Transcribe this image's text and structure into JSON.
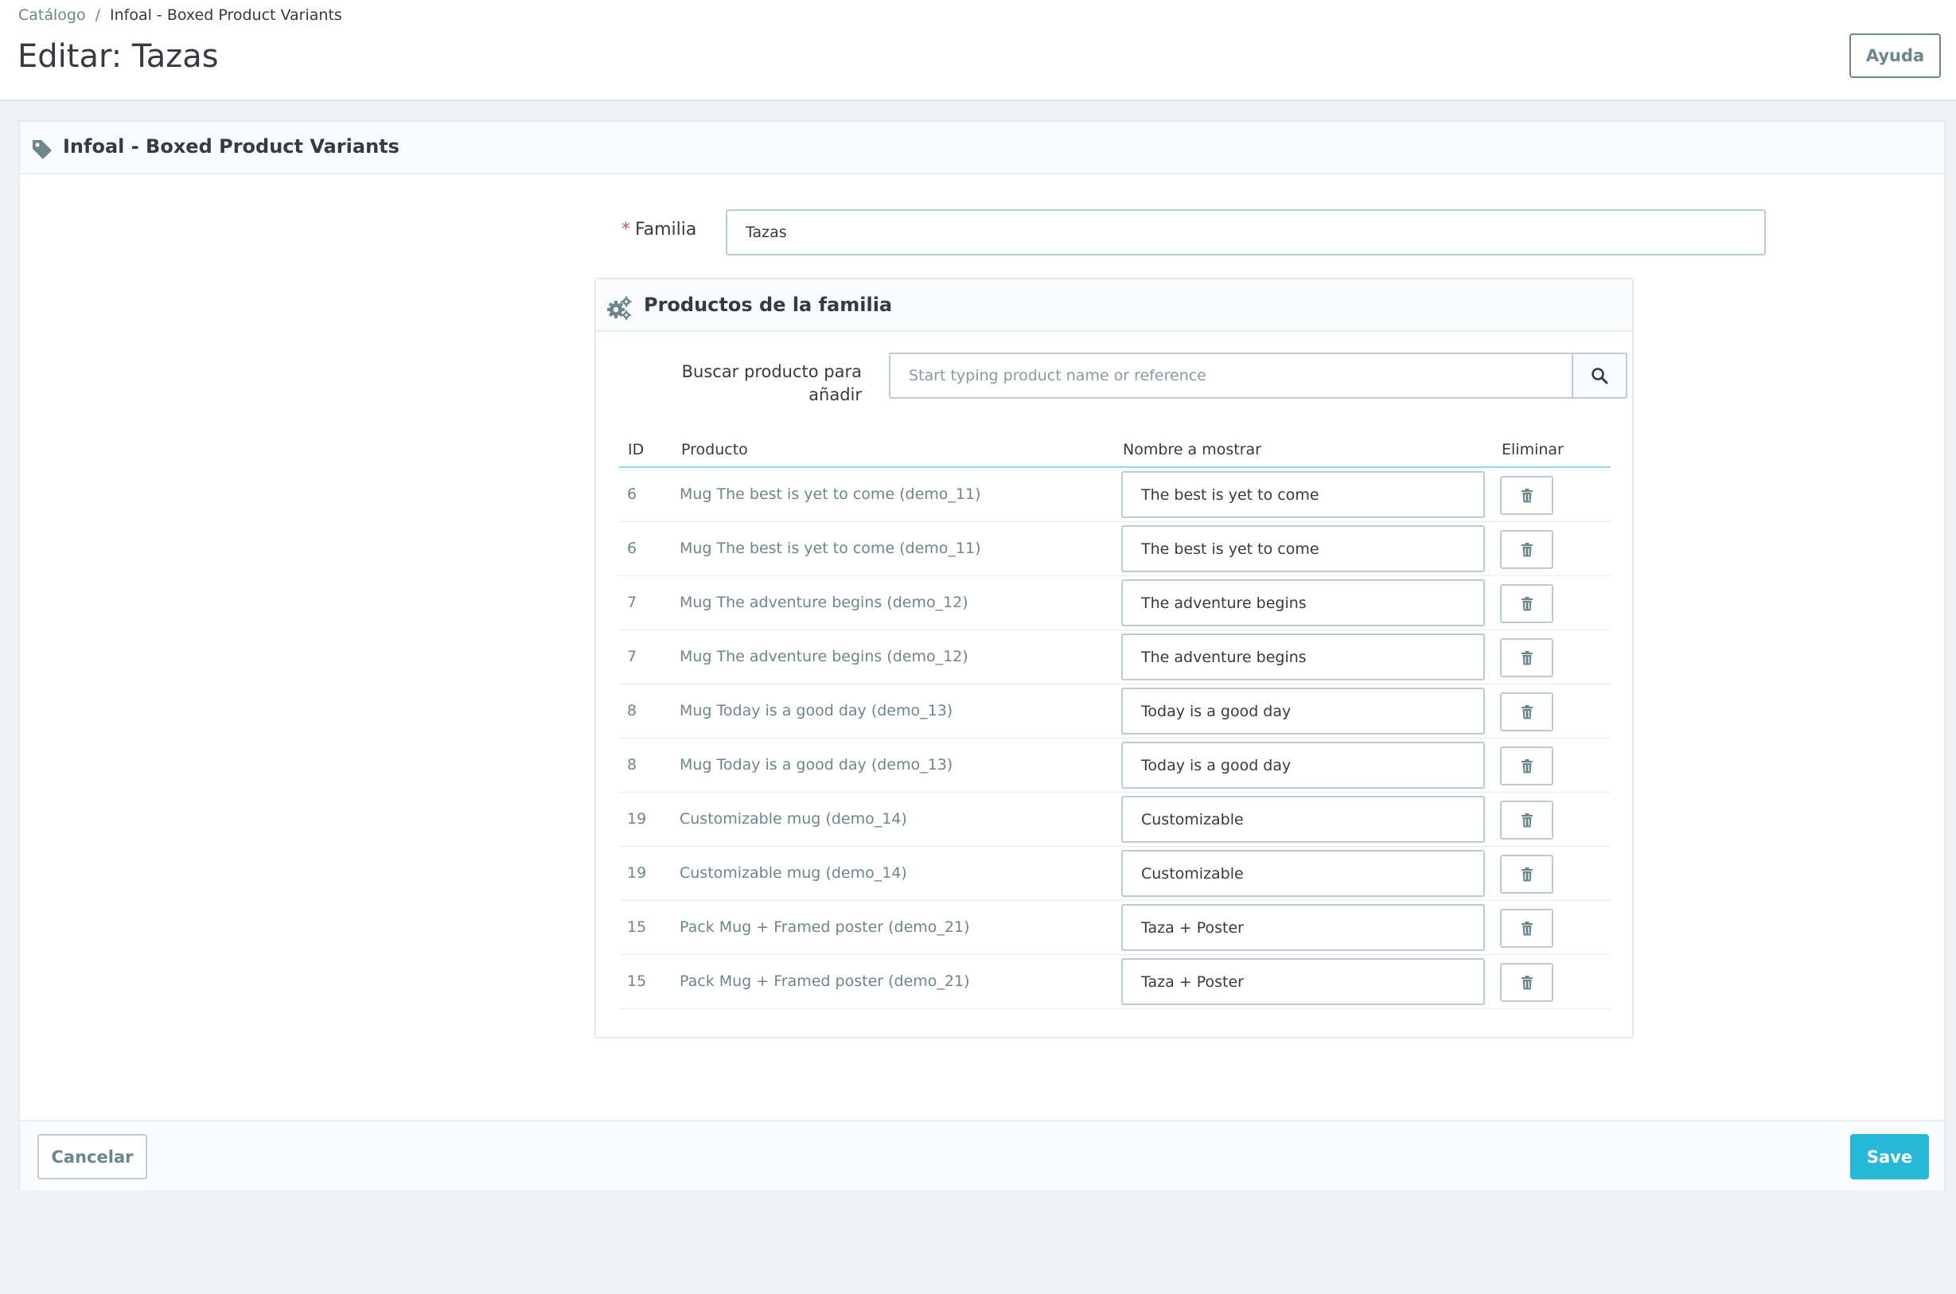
{
  "breadcrumb": {
    "parent": "Catálogo",
    "separator": "/",
    "current": "Infoal - Boxed Product Variants"
  },
  "header": {
    "title": "Editar: Tazas",
    "help_label": "Ayuda"
  },
  "panel": {
    "title": "Infoal - Boxed Product Variants",
    "icon": "tag-icon",
    "family_label": "Familia",
    "family_required_mark": "*",
    "family_value": "Tazas"
  },
  "products_panel": {
    "title": "Productos de la familia",
    "icon": "cogs-icon",
    "search_label": "Buscar producto para añadir",
    "search_placeholder": "Start typing product name or reference",
    "columns": {
      "id": "ID",
      "product": "Producto",
      "display_name": "Nombre a mostrar",
      "delete": "Eliminar"
    },
    "rows": [
      {
        "id": "6",
        "product": "Mug The best is yet to come (demo_11)",
        "display_name": "The best is yet to come"
      },
      {
        "id": "6",
        "product": "Mug The best is yet to come (demo_11)",
        "display_name": "The best is yet to come"
      },
      {
        "id": "7",
        "product": "Mug The adventure begins (demo_12)",
        "display_name": "The adventure begins"
      },
      {
        "id": "7",
        "product": "Mug The adventure begins (demo_12)",
        "display_name": "The adventure begins"
      },
      {
        "id": "8",
        "product": "Mug Today is a good day (demo_13)",
        "display_name": "Today is a good day"
      },
      {
        "id": "8",
        "product": "Mug Today is a good day (demo_13)",
        "display_name": "Today is a good day"
      },
      {
        "id": "19",
        "product": "Customizable mug (demo_14)",
        "display_name": "Customizable"
      },
      {
        "id": "19",
        "product": "Customizable mug (demo_14)",
        "display_name": "Customizable"
      },
      {
        "id": "15",
        "product": "Pack Mug + Framed poster (demo_21)",
        "display_name": "Taza + Poster"
      },
      {
        "id": "15",
        "product": "Pack Mug + Framed poster (demo_21)",
        "display_name": "Taza + Poster"
      }
    ]
  },
  "footer": {
    "cancel_label": "Cancelar",
    "save_label": "Save"
  },
  "colors": {
    "accent": "#25b9d7",
    "text": "#363a41",
    "muted": "#6c868e",
    "required": "#c05c67",
    "background": "#eff1f2"
  }
}
